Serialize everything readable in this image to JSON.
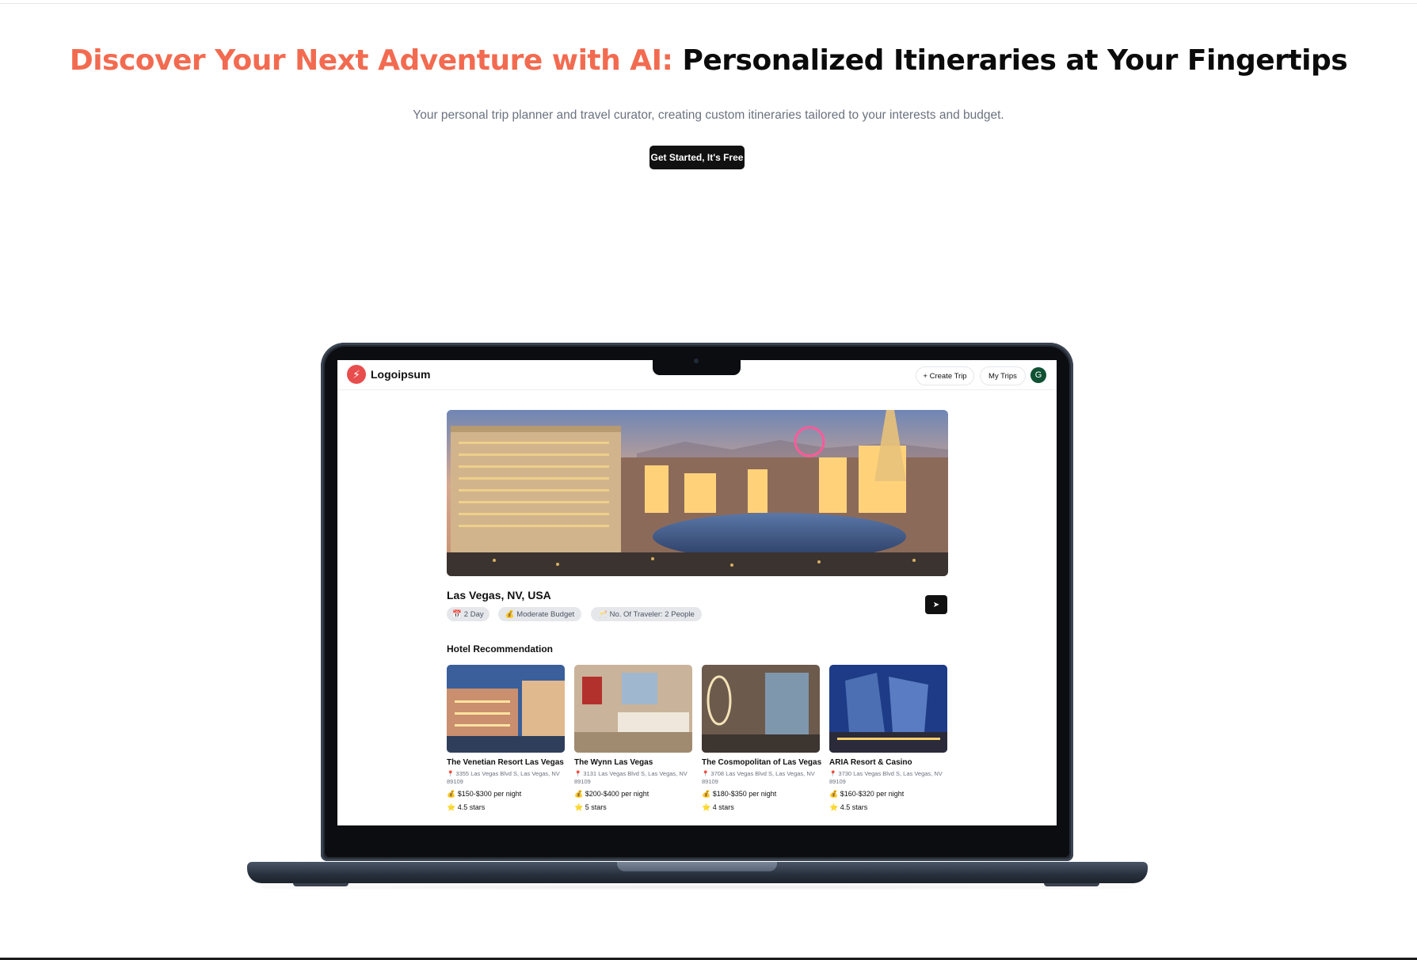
{
  "hero": {
    "title_accent": "Discover Your Next Adventure with AI:",
    "title_rest": "Personalized Itineraries at Your Fingertips",
    "subtitle": "Your personal trip planner and travel curator, creating custom itineraries tailored to your interests and budget.",
    "cta_label": "Get Started, It's Free"
  },
  "app": {
    "logo_text": "Logoipsum",
    "create_trip_label": "+ Create Trip",
    "my_trips_label": "My Trips",
    "avatar_initial": "G",
    "trip": {
      "title": "Las Vegas, NV, USA",
      "days_chip": "📅 2 Day",
      "budget_chip": "💰 Moderate Budget",
      "travelers_chip": "🥂 No. Of Traveler: 2 People",
      "share_icon": "send-icon"
    },
    "hotel_section_title": "Hotel Recommendation",
    "hotels": [
      {
        "name": "The Venetian Resort Las Vegas",
        "address": "📍 3355 Las Vegas Blvd S, Las Vegas, NV 89109",
        "price": "💰 $150-$300 per night",
        "rating": "⭐ 4.5 stars"
      },
      {
        "name": "The Wynn Las Vegas",
        "address": "📍 3131 Las Vegas Blvd S, Las Vegas, NV 89109",
        "price": "💰 $200-$400 per night",
        "rating": "⭐ 5 stars"
      },
      {
        "name": "The Cosmopolitan of Las Vegas",
        "address": "📍 3708 Las Vegas Blvd S, Las Vegas, NV 89109",
        "price": "💰 $180-$350 per night",
        "rating": "⭐ 4 stars"
      },
      {
        "name": "ARIA Resort & Casino",
        "address": "📍 3730 Las Vegas Blvd S, Las Vegas, NV 89109",
        "price": "💰 $160-$320 per night",
        "rating": "⭐ 4.5 stars"
      }
    ]
  },
  "colors": {
    "accent": "#f26b50",
    "dark": "#0b0b0b",
    "avatar": "#0f5132",
    "logo": "#e84d4d"
  }
}
